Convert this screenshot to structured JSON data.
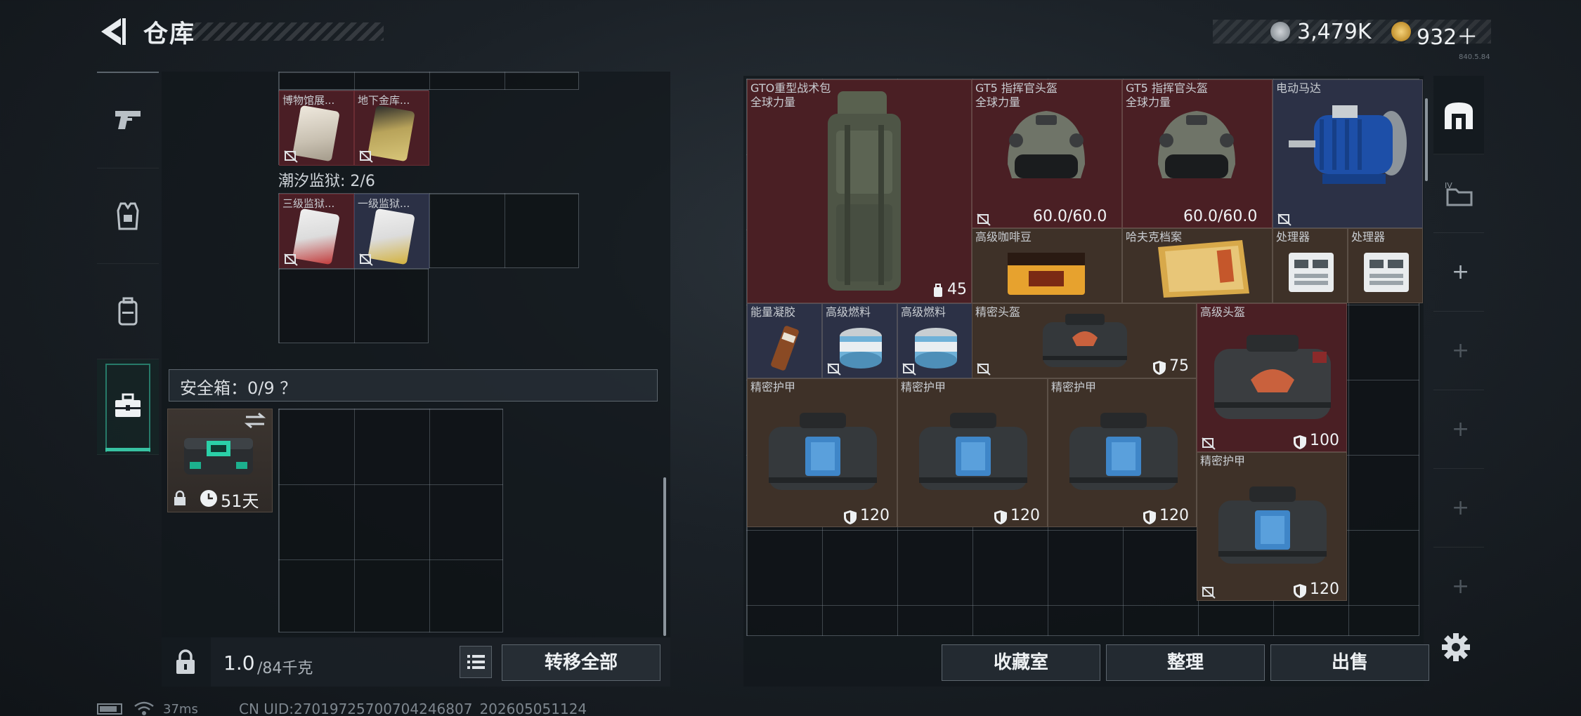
{
  "header": {
    "title": "仓库",
    "currency_silver": "3,479K",
    "currency_gold": "932＋",
    "version": "840.5.84"
  },
  "left_tabs": [
    {
      "name": "weapons",
      "icon": "pistol-icon"
    },
    {
      "name": "equipment",
      "icon": "vest-icon"
    },
    {
      "name": "backpack",
      "icon": "backpack-icon"
    },
    {
      "name": "safe-box",
      "icon": "toolbox-icon",
      "active": true
    }
  ],
  "left_inventory": {
    "museum_cards": [
      {
        "label": "博物馆展...",
        "color": "#c9c1b2"
      },
      {
        "label": "地下金库...",
        "color": "#b8a35a"
      }
    ],
    "prison_label": "潮汐监狱: 2/6",
    "prison_cards": [
      {
        "label": "三级监狱...",
        "color": "#c23a3a"
      },
      {
        "label": "一级监狱...",
        "color": "#d3b13b"
      }
    ],
    "safe_box": {
      "header": "安全箱：0/9 ？",
      "days": "51天"
    },
    "weight_current": "1.0",
    "weight_max": "/84千克",
    "transfer_all": "转移全部"
  },
  "right_inventory": {
    "items": [
      {
        "label": "GTO重型战术包",
        "sub": "全球力量",
        "stat": "45",
        "stat_icon": "backpack-mini-icon"
      },
      {
        "label": "GT5 指挥官头盔",
        "sub": "全球力量",
        "stat": "60.0/60.0"
      },
      {
        "label": "GT5 指挥官头盔",
        "sub": "全球力量",
        "stat": "60.0/60.0"
      },
      {
        "label": "电动马达"
      },
      {
        "label": "高级咖啡豆"
      },
      {
        "label": "哈夫克档案"
      },
      {
        "label": "处理器"
      },
      {
        "label": "处理器"
      },
      {
        "label": "能量凝胶"
      },
      {
        "label": "高级燃料"
      },
      {
        "label": "高级燃料"
      },
      {
        "label": "精密头盔",
        "stat": "75"
      },
      {
        "label": "高级头盔",
        "stat": "100"
      },
      {
        "label": "精密护甲",
        "stat": "120"
      },
      {
        "label": "精密护甲",
        "stat": "120"
      },
      {
        "label": "精密护甲",
        "stat": "120"
      },
      {
        "label": "精密护甲",
        "stat": "120"
      }
    ],
    "buttons": {
      "collection_room": "收藏室",
      "organize": "整理",
      "sell": "出售"
    }
  },
  "right_tabs": [
    "+",
    "+",
    "+",
    "+",
    "+"
  ],
  "status_bar": {
    "ping": "37ms",
    "uid": "CN UID:27019725700704246807_202605051124"
  },
  "colors": {
    "accent": "#37c2a2",
    "card_red": "#4a1f24",
    "card_brown": "#3e3128",
    "card_blue": "#2c3146"
  }
}
